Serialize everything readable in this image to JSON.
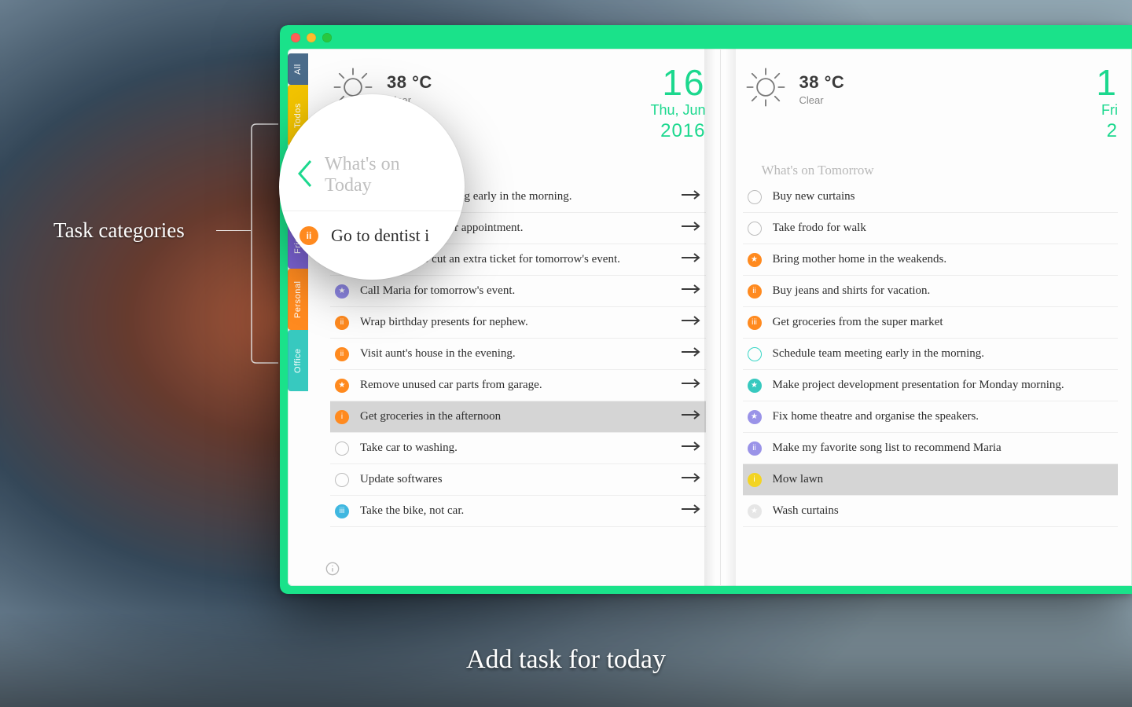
{
  "annotations": {
    "left_callout": "Task categories",
    "bottom_caption": "Add task for today"
  },
  "sidebar": {
    "tabs": [
      {
        "label": "All",
        "color": "#4a6b8a"
      },
      {
        "label": "Todos",
        "color": "#f3c400"
      },
      {
        "label": "",
        "color": "#6fc6d8"
      },
      {
        "label": "Friends",
        "color": "#7d64d6"
      },
      {
        "label": "Personal",
        "color": "#ff8a1f"
      },
      {
        "label": "Office",
        "color": "#37c9bf"
      }
    ]
  },
  "today": {
    "weather": {
      "temp": "38 °C",
      "condition": "Clear"
    },
    "date": {
      "daynum": "16",
      "daylabel": "Thu, Jun",
      "year": "2016"
    },
    "section_title": "What's on Today",
    "tasks": [
      {
        "text": "Schedule team meeting early in the morning.",
        "dot": "hollow",
        "color": "#38d6c6",
        "arrow": true
      },
      {
        "text": "Call Dr. Harrison for appointment.",
        "dot": "empty",
        "color": "",
        "arrow": true
      },
      {
        "text": "Don't forget to cut an extra ticket for tomorrow's event.",
        "dot": "fill",
        "glyph": "iii",
        "color": "#e94a9c",
        "arrow": true
      },
      {
        "text": "Call Maria for tomorrow's event.",
        "dot": "fill",
        "glyph": "★",
        "color": "#8f88e6",
        "arrow": true
      },
      {
        "text": "Wrap birthday presents for nephew.",
        "dot": "fill",
        "glyph": "ii",
        "color": "#ff8a1f",
        "arrow": true
      },
      {
        "text": "Visit aunt's house in the evening.",
        "dot": "fill",
        "glyph": "ii",
        "color": "#ff8a1f",
        "arrow": true
      },
      {
        "text": "Remove unused car parts from garage.",
        "dot": "fill",
        "glyph": "★",
        "color": "#ff8a1f",
        "arrow": true
      },
      {
        "text": "Get groceries in the afternoon",
        "dot": "fill",
        "glyph": "i",
        "color": "#ff8a1f",
        "arrow": true,
        "selected": true
      },
      {
        "text": "Take car to washing.",
        "dot": "empty",
        "color": "",
        "arrow": true
      },
      {
        "text": "Update softwares",
        "dot": "empty",
        "color": "",
        "arrow": true
      },
      {
        "text": "Take the bike, not car.",
        "dot": "fill",
        "glyph": "iii",
        "color": "#3fb7e0",
        "arrow": true
      }
    ]
  },
  "tomorrow": {
    "weather": {
      "temp": "38 °C",
      "condition": "Clear"
    },
    "date": {
      "daynum": "1",
      "daylabel": "Fri",
      "year": "2"
    },
    "section_title": "What's on Tomorrow",
    "tasks": [
      {
        "text": "Buy new curtains",
        "dot": "empty",
        "color": ""
      },
      {
        "text": "Take frodo for walk",
        "dot": "empty",
        "color": ""
      },
      {
        "text": "Bring mother home in the weakends.",
        "dot": "fill",
        "glyph": "★",
        "color": "#ff8a1f"
      },
      {
        "text": "Buy jeans and shirts for vacation.",
        "dot": "fill",
        "glyph": "ii",
        "color": "#ff8a1f"
      },
      {
        "text": "Get groceries from the super market",
        "dot": "fill",
        "glyph": "iii",
        "color": "#ff8a1f"
      },
      {
        "text": "Schedule team meeting early in the morning.",
        "dot": "hollow",
        "color": "#38d6c6"
      },
      {
        "text": "Make project development presentation for Monday morning.",
        "dot": "fill",
        "glyph": "★",
        "color": "#37c9bf"
      },
      {
        "text": "Fix home theatre and organise the speakers.",
        "dot": "fill",
        "glyph": "★",
        "color": "#9a93e8"
      },
      {
        "text": "Make my favorite song list to recommend Maria",
        "dot": "fill",
        "glyph": "ii",
        "color": "#9a93e8"
      },
      {
        "text": "Mow lawn",
        "dot": "fill",
        "glyph": "i",
        "color": "#f3d423",
        "selected": true
      },
      {
        "text": "Wash curtains",
        "dot": "fill",
        "glyph": "★",
        "color": "#e6e6e6"
      }
    ]
  },
  "zoom": {
    "title": "What's on Today",
    "task": "Go to dentist i",
    "dot_glyph": "ii",
    "dot_color": "#ff8a1f"
  }
}
